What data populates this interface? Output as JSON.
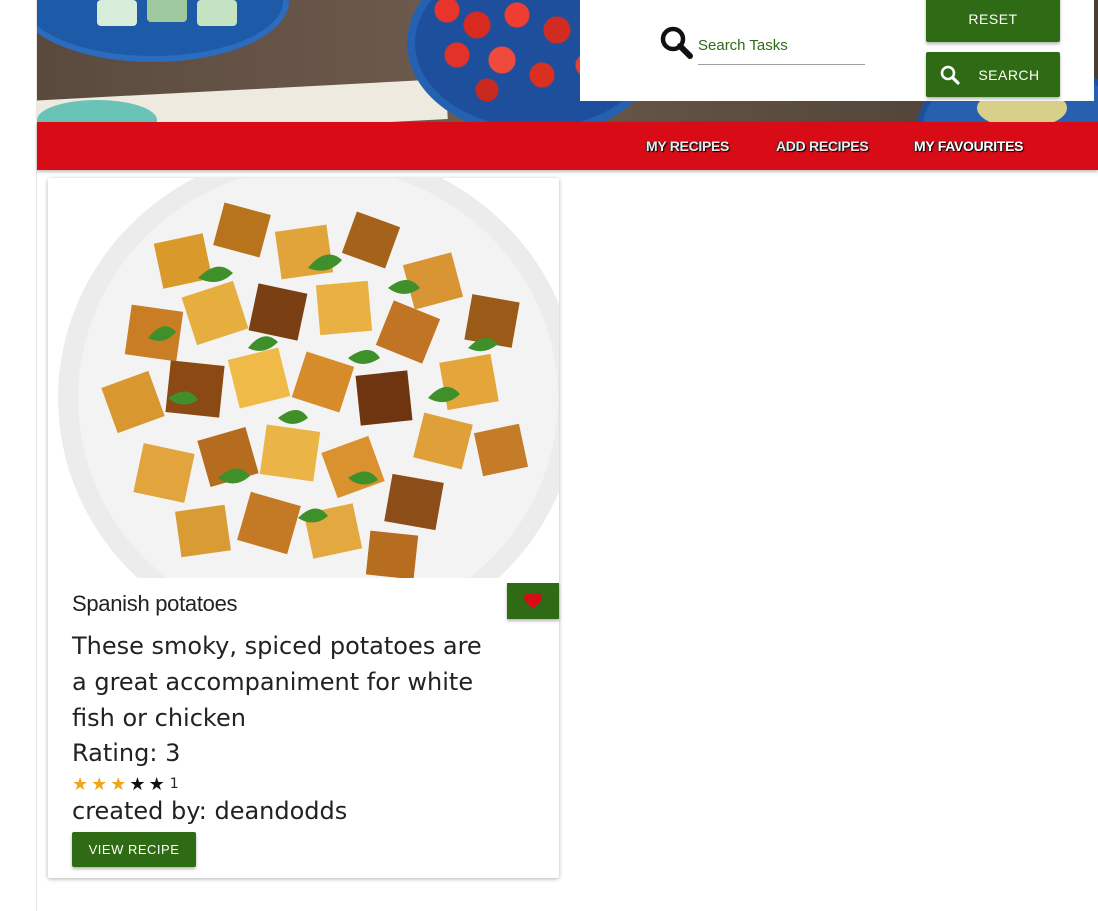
{
  "search": {
    "placeholder": "Search Tasks",
    "reset_label": "RESET",
    "search_label": "SEARCH"
  },
  "nav": {
    "items": [
      {
        "label": "MY RECIPES",
        "active": false
      },
      {
        "label": "ADD RECIPES",
        "active": false
      },
      {
        "label": "MY FAVOURITES",
        "active": true
      }
    ]
  },
  "recipe": {
    "title": "Spanish potatoes",
    "description": "These smoky, spiced potatoes are a great accompaniment for white fish or chicken",
    "rating_label": "Rating: 3",
    "stars_filled": 3,
    "stars_total": 5,
    "votes": "1",
    "created_by": "created by: deandodds",
    "view_label": "VIEW RECIPE",
    "favourite_icon": "heart-icon"
  },
  "colors": {
    "nav_red": "#d80b17",
    "button_green": "#2e6b14",
    "star_gold": "#f0a51a",
    "heart_red": "#d80b17"
  }
}
